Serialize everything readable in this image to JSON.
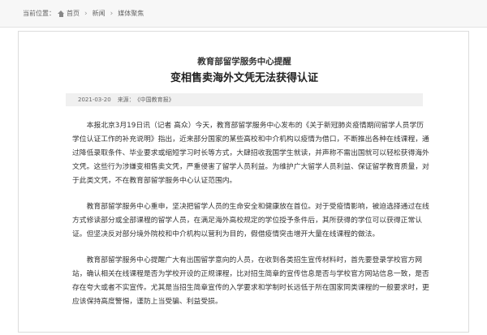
{
  "breadcrumb": {
    "prefix": "当前位置：",
    "items": [
      "首页",
      "新闻",
      "媒体聚焦"
    ]
  },
  "article": {
    "kicker": "教育部留学服务中心提醒",
    "title": "变相售卖海外文凭无法获得认证",
    "date": "2021-03-20",
    "source_label": "来源：",
    "source": "《中国教育报》",
    "paragraphs": [
      "本报北京3月19日讯（记者 高众）今天，教育部留学服务中心发布的《关于新冠肺炎疫情期间留学人员学历学位认证工作的补充说明》指出，近来部分国家的某些高校和中介机构以疫情为借口，不断推出各种在线课程，通过降低录取条件、毕业要求或缩短学习时长等方式，大肆招收我国学生就读，并声称不需出国就可以轻松获得海外文凭。这些行为涉嫌变相售卖文凭，严重侵害了留学人员利益。为维护广大留学人员利益、保证留学教育质量，对于此类文凭，不在教育部留学服务中心认证范围内。",
      "教育部留学服务中心重申，坚决把留学人员的生命安全和健康放在首位。对于受疫情影响，被迫选择通过在线方式修读部分或全部课程的留学人员，在满足海外高校规定的学位授予条件后，其所获得的学位可以获得正常认证。但坚决反对部分境外院校和中介机构以营利为目的，假借疫情突击增开大量在线课程的做法。",
      "教育部留学服务中心提醒广大有出国留学意向的人员，在收到各类招生宣传材料时，首先要登录学校官方网站，确认相关在线课程是否为学校开设的正规课程，比对招生简章的宣传信息是否与学校官方网站信息一致，是否存在夸大或者不实宣传。尤其是当招生简章宣传的入学要求和学制时长远低于所在国家同类课程的一般要求时，更应该保持高度警惕，谨防上当受骗、利益受损。"
    ]
  }
}
